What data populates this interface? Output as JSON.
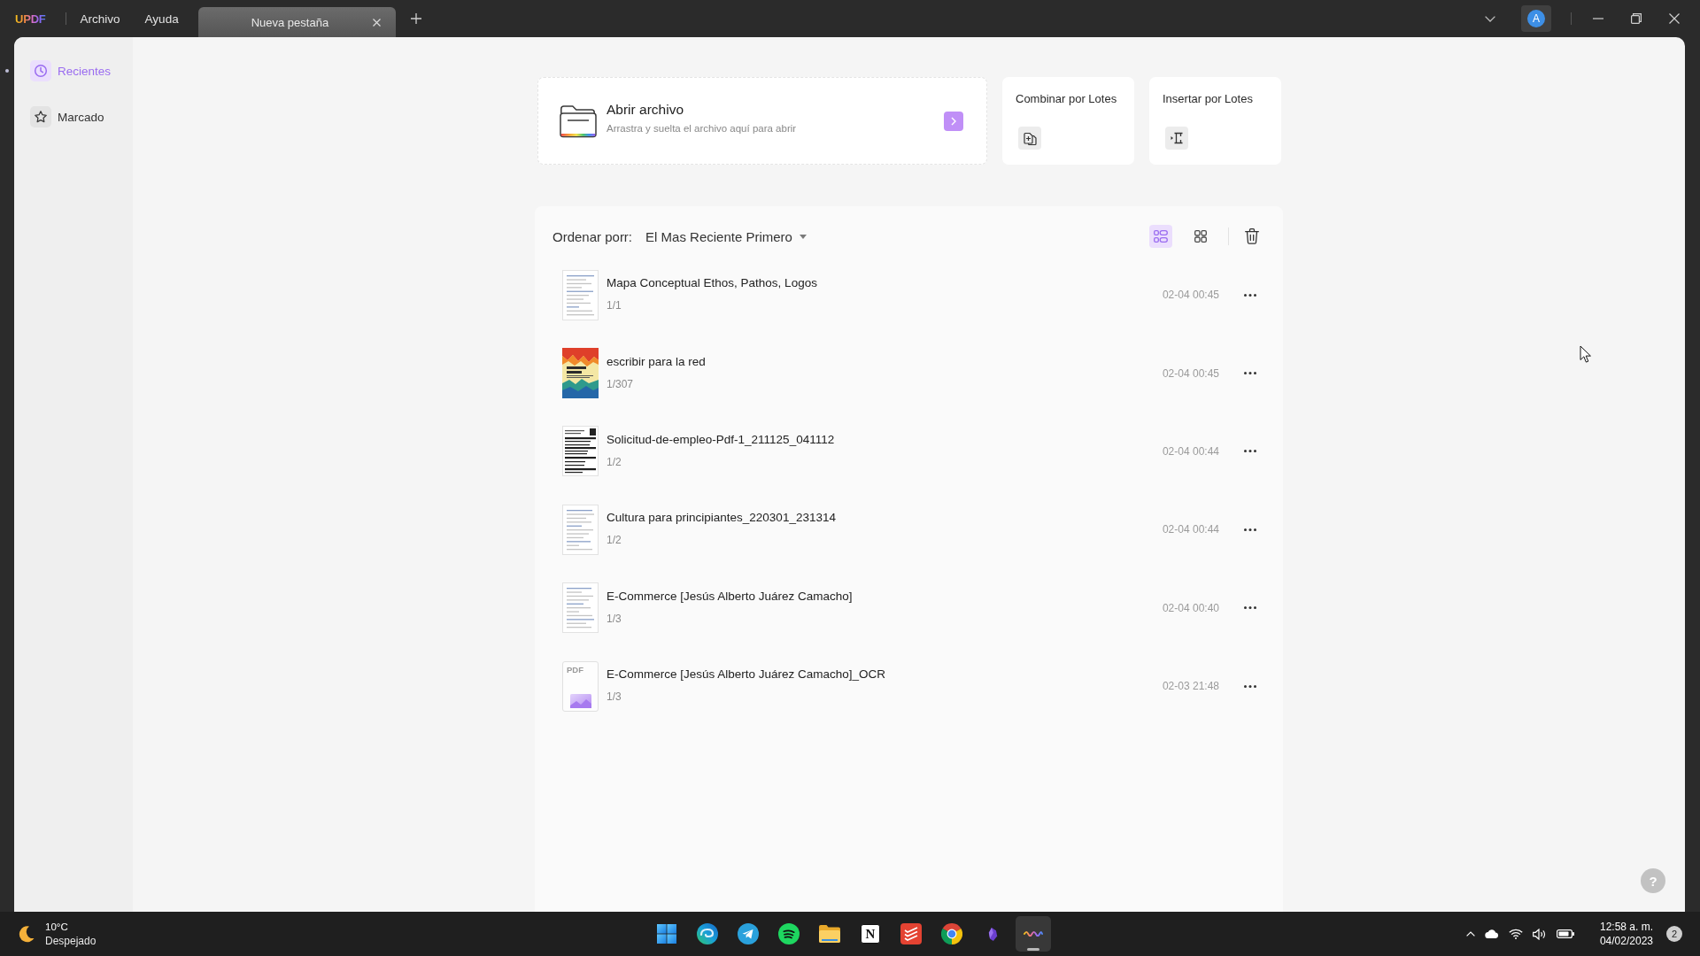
{
  "title_bar": {
    "logo": "UPDF",
    "menu": [
      "Archivo",
      "Ayuda"
    ],
    "tabs": [
      {
        "label": "Nueva pestaña",
        "selected": true
      }
    ],
    "avatar": "A"
  },
  "sidebar": {
    "items": [
      {
        "label": "Recientes",
        "selected": true
      },
      {
        "label": "Marcado",
        "selected": false
      }
    ]
  },
  "open_file": {
    "title": "Abrir archivo",
    "subtitle": "Arrastra y suelta el archivo aquí para abrir"
  },
  "batch_actions": [
    {
      "label": "Combinar por Lotes"
    },
    {
      "label": "Insertar por Lotes"
    }
  ],
  "file_list": {
    "sort_label": "Ordenar porr:",
    "sort_value": "El Mas Reciente Primero",
    "views": [
      {
        "selected": true
      },
      {
        "selected": false
      }
    ],
    "files": [
      {
        "kind": "page",
        "name": "Mapa Conceptual Ethos, Pathos, Logos",
        "pages": "1/1",
        "date": "02-04 00:45"
      },
      {
        "kind": "cover",
        "name": "escribir para la red",
        "pages": "1/307",
        "date": "02-04 00:45"
      },
      {
        "kind": "form",
        "name": "Solicitud-de-empleo-Pdf-1_211125_041112",
        "pages": "1/2",
        "date": "02-04 00:44"
      },
      {
        "kind": "page",
        "name": "Cultura para principiantes_220301_231314",
        "pages": "1/2",
        "date": "02-04 00:44"
      },
      {
        "kind": "page",
        "name": "E-Commerce [Jesús Alberto Juárez Camacho]",
        "pages": "1/3",
        "date": "02-04 00:40"
      },
      {
        "kind": "pdf",
        "name": "E-Commerce [Jesús Alberto Juárez Camacho]_OCR",
        "pages": "1/3",
        "date": "02-03 21:48",
        "thumbnail_label": "PDF"
      }
    ]
  },
  "help": "?",
  "taskbar": {
    "weather": {
      "temperature": "10°C",
      "condition": "Despejado"
    },
    "apps": [
      {
        "active": false
      },
      {
        "active": false
      },
      {
        "active": false
      },
      {
        "active": false
      },
      {
        "active": false
      },
      {
        "active": false,
        "glyph": "N"
      },
      {
        "active": false
      },
      {
        "active": false
      },
      {
        "active": false
      },
      {
        "active": true
      }
    ],
    "time": "12:58 a. m.",
    "date": "04/02/2023",
    "notifications": "2"
  }
}
